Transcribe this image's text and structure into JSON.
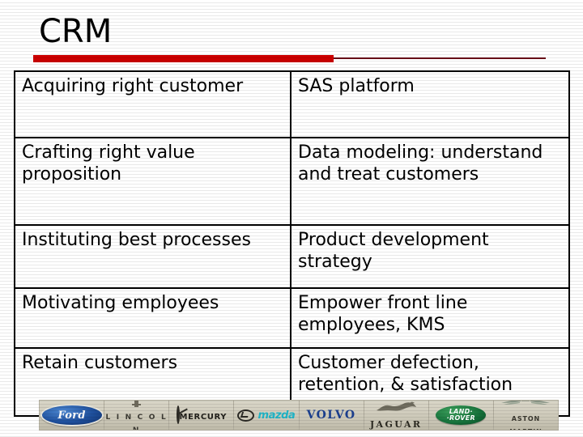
{
  "slide": {
    "title": "CRM",
    "accent_color_thick": "#cc0000",
    "accent_color_thin": "#6b0d18",
    "background_color": "#ffffff"
  },
  "table": {
    "rows": [
      {
        "left": "Acquiring right customer",
        "right": "SAS platform"
      },
      {
        "left": "Crafting right value proposition",
        "right": "Data modeling: understand and treat customers"
      },
      {
        "left": "Instituting best processes",
        "right": "Product development strategy"
      },
      {
        "left": "Motivating employees",
        "right": "Empower front line employees, KMS"
      },
      {
        "left": "Retain customers",
        "right": "Customer defection, retention, & satisfaction"
      }
    ]
  },
  "logo_strip": {
    "brands": [
      {
        "name": "Ford",
        "label": "Ford",
        "color": "#1e4f9c"
      },
      {
        "name": "Lincoln",
        "label": "L I N C O L N",
        "color": "#3c3a33"
      },
      {
        "name": "Mercury",
        "label": "MERCURY",
        "color": "#23211c"
      },
      {
        "name": "Mazda",
        "label": "mazda",
        "color": "#1fb6c9"
      },
      {
        "name": "Volvo",
        "label": "VOLVO",
        "color": "#1b3f8f"
      },
      {
        "name": "Jaguar",
        "label": "JAGUAR",
        "color": "#2a2820"
      },
      {
        "name": "Land Rover",
        "label_line1": "LAND·",
        "label_line2": "·ROVER",
        "color": "#14703a"
      },
      {
        "name": "Aston Martin",
        "label": "ASTON MARTIN",
        "color": "#3a382f"
      }
    ]
  }
}
